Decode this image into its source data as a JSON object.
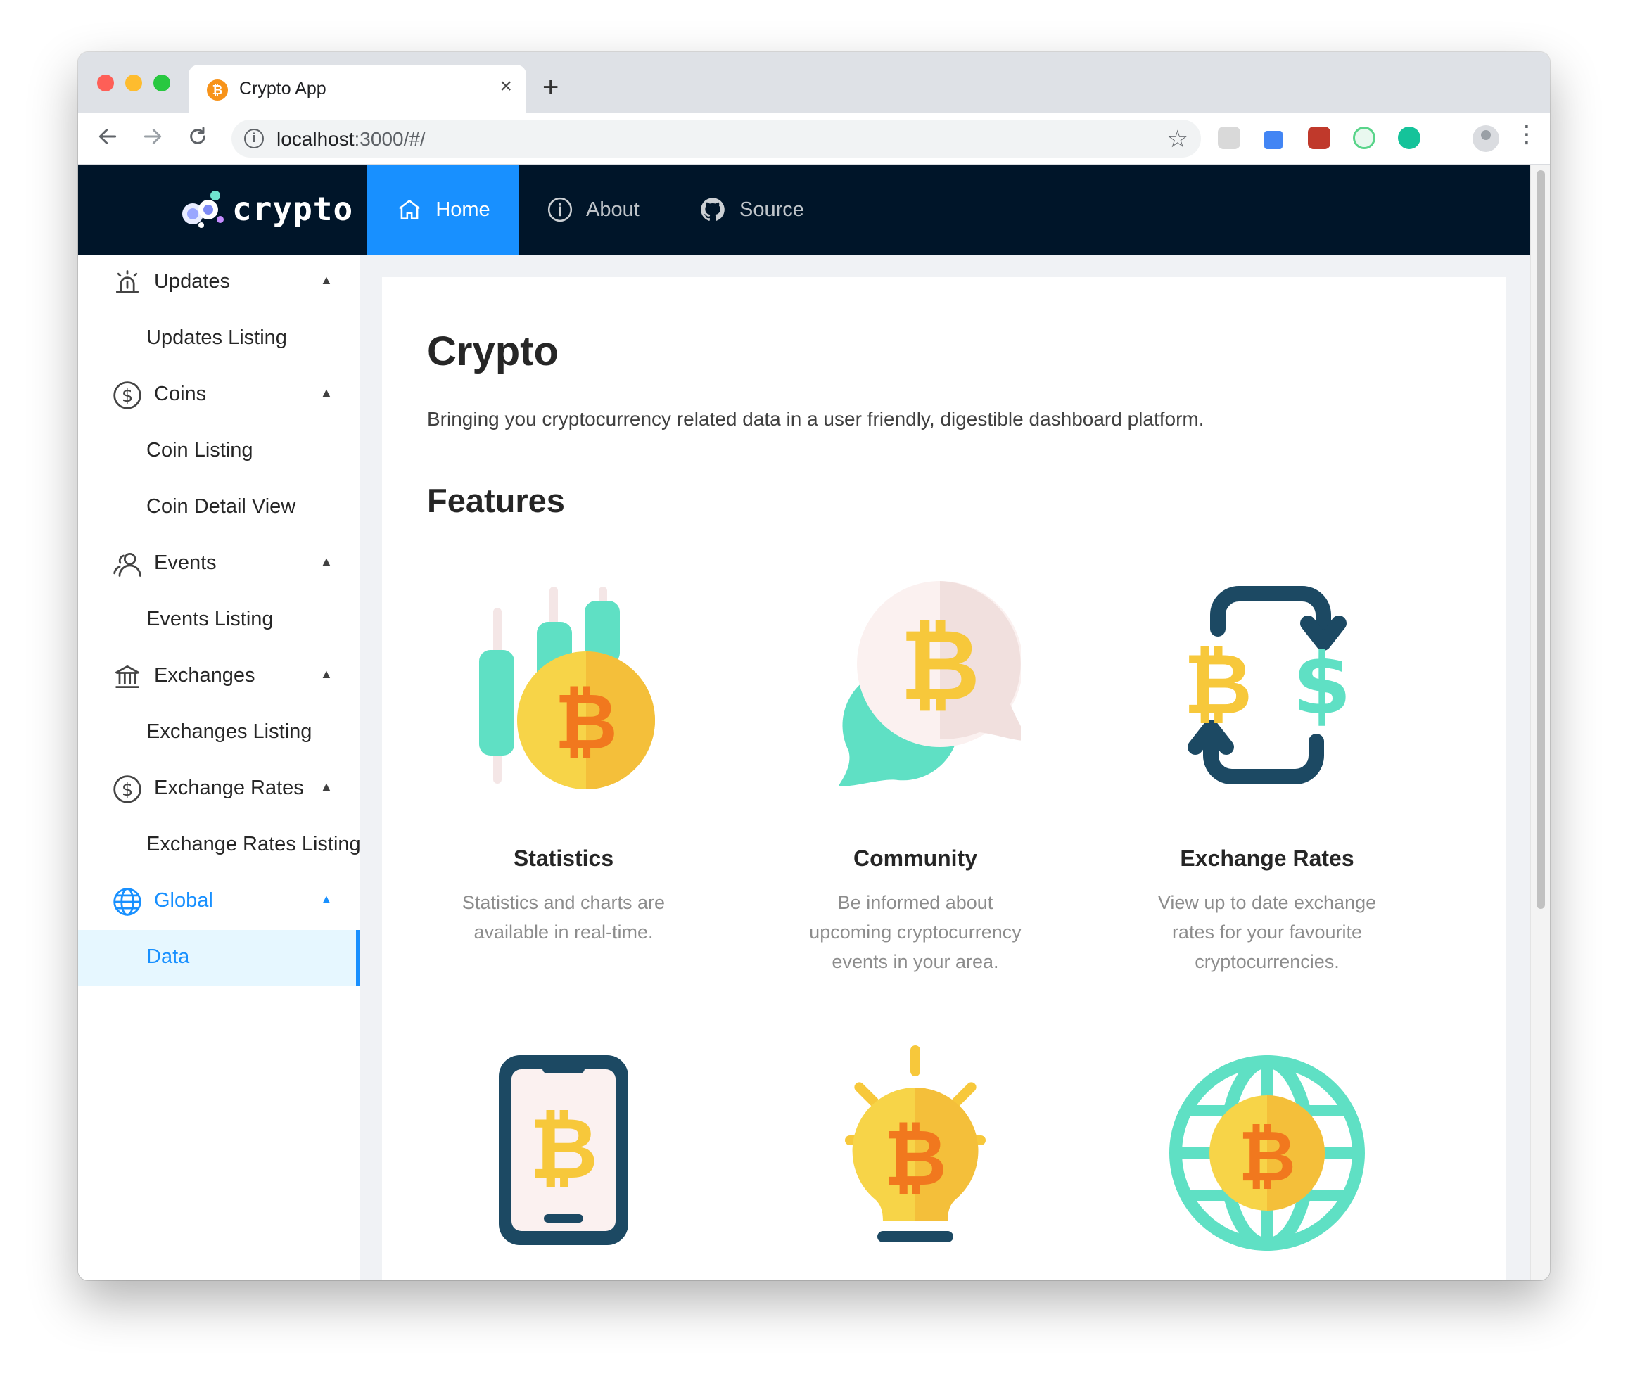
{
  "browser": {
    "tab_title": "Crypto App",
    "new_tab": "+",
    "close": "×",
    "url_host": "localhost",
    "url_rest": ":3000/#/"
  },
  "header": {
    "logo_text": "crypto",
    "nav": [
      {
        "label": "Home",
        "active": true,
        "icon": "home-icon"
      },
      {
        "label": "About",
        "active": false,
        "icon": "info-circle-icon"
      },
      {
        "label": "Source",
        "active": false,
        "icon": "github-icon"
      }
    ]
  },
  "sidebar": {
    "groups": [
      {
        "label": "Updates",
        "icon": "alarm-icon",
        "items": [
          "Updates Listing"
        ]
      },
      {
        "label": "Coins",
        "icon": "dollar-icon",
        "items": [
          "Coin Listing",
          "Coin Detail View"
        ]
      },
      {
        "label": "Events",
        "icon": "team-icon",
        "items": [
          "Events Listing"
        ]
      },
      {
        "label": "Exchanges",
        "icon": "bank-icon",
        "items": [
          "Exchanges Listing"
        ]
      },
      {
        "label": "Exchange Rates",
        "icon": "dollar-icon",
        "items": [
          "Exchange Rates Listing"
        ]
      },
      {
        "label": "Global",
        "icon": "global-icon",
        "items": [
          "Data"
        ],
        "active": true,
        "selected_item": "Data"
      }
    ]
  },
  "main": {
    "title": "Crypto",
    "intro": "Bringing you cryptocurrency related data in a user friendly, digestible dashboard platform.",
    "features_heading": "Features",
    "features": [
      {
        "title": "Statistics",
        "description": "Statistics and charts are available in real-time.",
        "icon": "candlestick-bitcoin-icon"
      },
      {
        "title": "Community",
        "description": "Be informed about upcoming cryptocurrency events in your area.",
        "icon": "chat-bitcoin-icon"
      },
      {
        "title": "Exchange Rates",
        "description": "View up to date exchange rates for your favourite cryptocurrencies.",
        "icon": "exchange-arrows-icon"
      },
      {
        "icon": "phone-bitcoin-icon"
      },
      {
        "icon": "lightbulb-bitcoin-icon"
      },
      {
        "icon": "globe-bitcoin-icon"
      }
    ]
  },
  "colors": {
    "header_bg": "#001529",
    "accent": "#1890ff",
    "page_bg": "#f0f2f5",
    "bitcoin_yellow": "#f7cc3b",
    "bitcoin_orange": "#f1781e",
    "teal": "#5fe0c4",
    "navy": "#1c4963"
  }
}
